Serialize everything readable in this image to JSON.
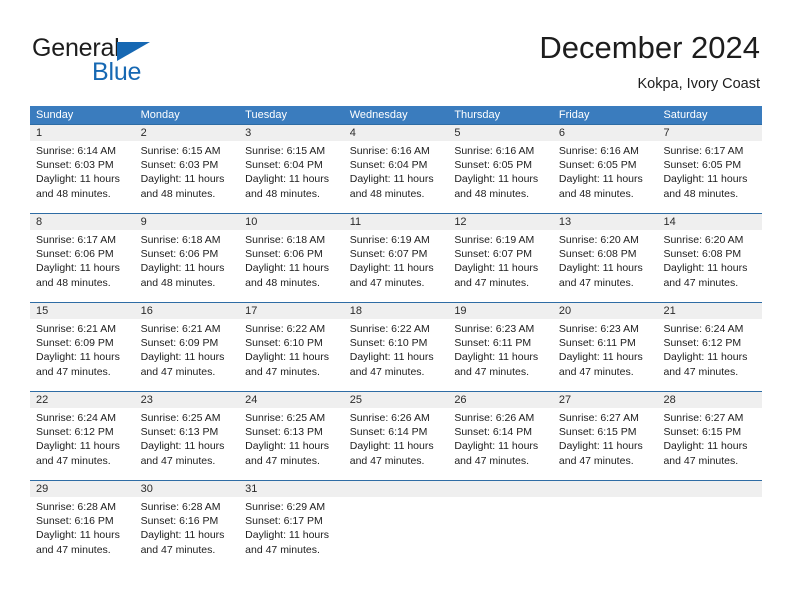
{
  "brand": {
    "name_top": "General",
    "name_bottom": "Blue",
    "color_blue": "#1668b3"
  },
  "header": {
    "title": "December 2024",
    "subtitle": "Kokpa, Ivory Coast"
  },
  "theme": {
    "header_blue": "#3a7cbe",
    "cell_band_gray": "#efefef",
    "cell_border_blue": "#2e6ca4"
  },
  "calendar": {
    "weekdays": [
      "Sunday",
      "Monday",
      "Tuesday",
      "Wednesday",
      "Thursday",
      "Friday",
      "Saturday"
    ],
    "weeks": [
      [
        {
          "day": "1",
          "sunrise": "Sunrise: 6:14 AM",
          "sunset": "Sunset: 6:03 PM",
          "daylight": "Daylight: 11 hours and 48 minutes."
        },
        {
          "day": "2",
          "sunrise": "Sunrise: 6:15 AM",
          "sunset": "Sunset: 6:03 PM",
          "daylight": "Daylight: 11 hours and 48 minutes."
        },
        {
          "day": "3",
          "sunrise": "Sunrise: 6:15 AM",
          "sunset": "Sunset: 6:04 PM",
          "daylight": "Daylight: 11 hours and 48 minutes."
        },
        {
          "day": "4",
          "sunrise": "Sunrise: 6:16 AM",
          "sunset": "Sunset: 6:04 PM",
          "daylight": "Daylight: 11 hours and 48 minutes."
        },
        {
          "day": "5",
          "sunrise": "Sunrise: 6:16 AM",
          "sunset": "Sunset: 6:05 PM",
          "daylight": "Daylight: 11 hours and 48 minutes."
        },
        {
          "day": "6",
          "sunrise": "Sunrise: 6:16 AM",
          "sunset": "Sunset: 6:05 PM",
          "daylight": "Daylight: 11 hours and 48 minutes."
        },
        {
          "day": "7",
          "sunrise": "Sunrise: 6:17 AM",
          "sunset": "Sunset: 6:05 PM",
          "daylight": "Daylight: 11 hours and 48 minutes."
        }
      ],
      [
        {
          "day": "8",
          "sunrise": "Sunrise: 6:17 AM",
          "sunset": "Sunset: 6:06 PM",
          "daylight": "Daylight: 11 hours and 48 minutes."
        },
        {
          "day": "9",
          "sunrise": "Sunrise: 6:18 AM",
          "sunset": "Sunset: 6:06 PM",
          "daylight": "Daylight: 11 hours and 48 minutes."
        },
        {
          "day": "10",
          "sunrise": "Sunrise: 6:18 AM",
          "sunset": "Sunset: 6:06 PM",
          "daylight": "Daylight: 11 hours and 48 minutes."
        },
        {
          "day": "11",
          "sunrise": "Sunrise: 6:19 AM",
          "sunset": "Sunset: 6:07 PM",
          "daylight": "Daylight: 11 hours and 47 minutes."
        },
        {
          "day": "12",
          "sunrise": "Sunrise: 6:19 AM",
          "sunset": "Sunset: 6:07 PM",
          "daylight": "Daylight: 11 hours and 47 minutes."
        },
        {
          "day": "13",
          "sunrise": "Sunrise: 6:20 AM",
          "sunset": "Sunset: 6:08 PM",
          "daylight": "Daylight: 11 hours and 47 minutes."
        },
        {
          "day": "14",
          "sunrise": "Sunrise: 6:20 AM",
          "sunset": "Sunset: 6:08 PM",
          "daylight": "Daylight: 11 hours and 47 minutes."
        }
      ],
      [
        {
          "day": "15",
          "sunrise": "Sunrise: 6:21 AM",
          "sunset": "Sunset: 6:09 PM",
          "daylight": "Daylight: 11 hours and 47 minutes."
        },
        {
          "day": "16",
          "sunrise": "Sunrise: 6:21 AM",
          "sunset": "Sunset: 6:09 PM",
          "daylight": "Daylight: 11 hours and 47 minutes."
        },
        {
          "day": "17",
          "sunrise": "Sunrise: 6:22 AM",
          "sunset": "Sunset: 6:10 PM",
          "daylight": "Daylight: 11 hours and 47 minutes."
        },
        {
          "day": "18",
          "sunrise": "Sunrise: 6:22 AM",
          "sunset": "Sunset: 6:10 PM",
          "daylight": "Daylight: 11 hours and 47 minutes."
        },
        {
          "day": "19",
          "sunrise": "Sunrise: 6:23 AM",
          "sunset": "Sunset: 6:11 PM",
          "daylight": "Daylight: 11 hours and 47 minutes."
        },
        {
          "day": "20",
          "sunrise": "Sunrise: 6:23 AM",
          "sunset": "Sunset: 6:11 PM",
          "daylight": "Daylight: 11 hours and 47 minutes."
        },
        {
          "day": "21",
          "sunrise": "Sunrise: 6:24 AM",
          "sunset": "Sunset: 6:12 PM",
          "daylight": "Daylight: 11 hours and 47 minutes."
        }
      ],
      [
        {
          "day": "22",
          "sunrise": "Sunrise: 6:24 AM",
          "sunset": "Sunset: 6:12 PM",
          "daylight": "Daylight: 11 hours and 47 minutes."
        },
        {
          "day": "23",
          "sunrise": "Sunrise: 6:25 AM",
          "sunset": "Sunset: 6:13 PM",
          "daylight": "Daylight: 11 hours and 47 minutes."
        },
        {
          "day": "24",
          "sunrise": "Sunrise: 6:25 AM",
          "sunset": "Sunset: 6:13 PM",
          "daylight": "Daylight: 11 hours and 47 minutes."
        },
        {
          "day": "25",
          "sunrise": "Sunrise: 6:26 AM",
          "sunset": "Sunset: 6:14 PM",
          "daylight": "Daylight: 11 hours and 47 minutes."
        },
        {
          "day": "26",
          "sunrise": "Sunrise: 6:26 AM",
          "sunset": "Sunset: 6:14 PM",
          "daylight": "Daylight: 11 hours and 47 minutes."
        },
        {
          "day": "27",
          "sunrise": "Sunrise: 6:27 AM",
          "sunset": "Sunset: 6:15 PM",
          "daylight": "Daylight: 11 hours and 47 minutes."
        },
        {
          "day": "28",
          "sunrise": "Sunrise: 6:27 AM",
          "sunset": "Sunset: 6:15 PM",
          "daylight": "Daylight: 11 hours and 47 minutes."
        }
      ],
      [
        {
          "day": "29",
          "sunrise": "Sunrise: 6:28 AM",
          "sunset": "Sunset: 6:16 PM",
          "daylight": "Daylight: 11 hours and 47 minutes."
        },
        {
          "day": "30",
          "sunrise": "Sunrise: 6:28 AM",
          "sunset": "Sunset: 6:16 PM",
          "daylight": "Daylight: 11 hours and 47 minutes."
        },
        {
          "day": "31",
          "sunrise": "Sunrise: 6:29 AM",
          "sunset": "Sunset: 6:17 PM",
          "daylight": "Daylight: 11 hours and 47 minutes."
        },
        {
          "day": "",
          "sunrise": "",
          "sunset": "",
          "daylight": ""
        },
        {
          "day": "",
          "sunrise": "",
          "sunset": "",
          "daylight": ""
        },
        {
          "day": "",
          "sunrise": "",
          "sunset": "",
          "daylight": ""
        },
        {
          "day": "",
          "sunrise": "",
          "sunset": "",
          "daylight": ""
        }
      ]
    ]
  }
}
